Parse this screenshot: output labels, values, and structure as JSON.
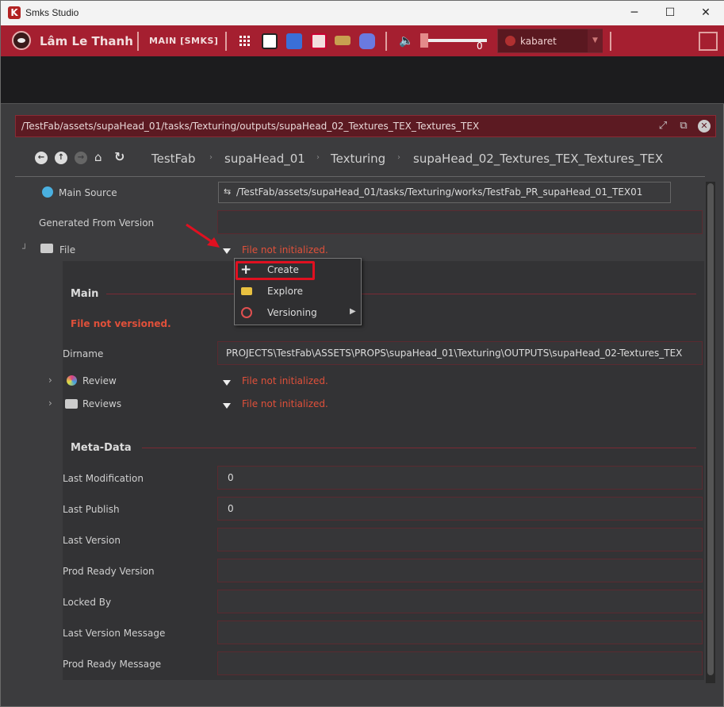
{
  "window": {
    "title": "Smks Studio",
    "min": "─",
    "max": "☐",
    "close": "✕"
  },
  "topbar": {
    "user": "Lâm Le Thanh",
    "project": "MAIN [SMKS]",
    "volume": "0",
    "studio": "kabaret"
  },
  "path": "/TestFab/assets/supaHead_01/tasks/Texturing/outputs/supaHead_02_Textures_TEX_Textures_TEX",
  "breadcrumbs": [
    "TestFab",
    "supaHead_01",
    "Texturing",
    "supaHead_02_Textures_TEX_Textures_TEX"
  ],
  "main_source": {
    "label": "Main Source",
    "value": "/TestFab/assets/supaHead_01/tasks/Texturing/works/TestFab_PR_supaHead_01_TEX01"
  },
  "generated_from": {
    "label": "Generated From Version",
    "value": ""
  },
  "file": {
    "label": "File",
    "status": "File not initialized."
  },
  "menu": {
    "create": "Create",
    "explore": "Explore",
    "versioning": "Versioning"
  },
  "main_section": {
    "title": "Main",
    "not_versioned": "File not versioned.",
    "dirname_label": "Dirname",
    "dirname_value": "PROJECTS\\TestFab\\ASSETS\\PROPS\\supaHead_01\\Texturing\\OUTPUTS\\supaHead_02-Textures_TEX",
    "review_label": "Review",
    "review_status": "File not initialized.",
    "reviews_label": "Reviews",
    "reviews_status": "File not initialized."
  },
  "meta": {
    "title": "Meta-Data",
    "rows": [
      {
        "label": "Last Modification",
        "value": "0"
      },
      {
        "label": "Last Publish",
        "value": "0"
      },
      {
        "label": "Last Version",
        "value": ""
      },
      {
        "label": "Prod Ready Version",
        "value": ""
      },
      {
        "label": "Locked By",
        "value": ""
      },
      {
        "label": "Last Version Message",
        "value": ""
      },
      {
        "label": "Prod Ready Message",
        "value": ""
      }
    ]
  },
  "colors": {
    "accent": "#a51f30",
    "error": "#e0503a",
    "highlight": "#e01020"
  }
}
